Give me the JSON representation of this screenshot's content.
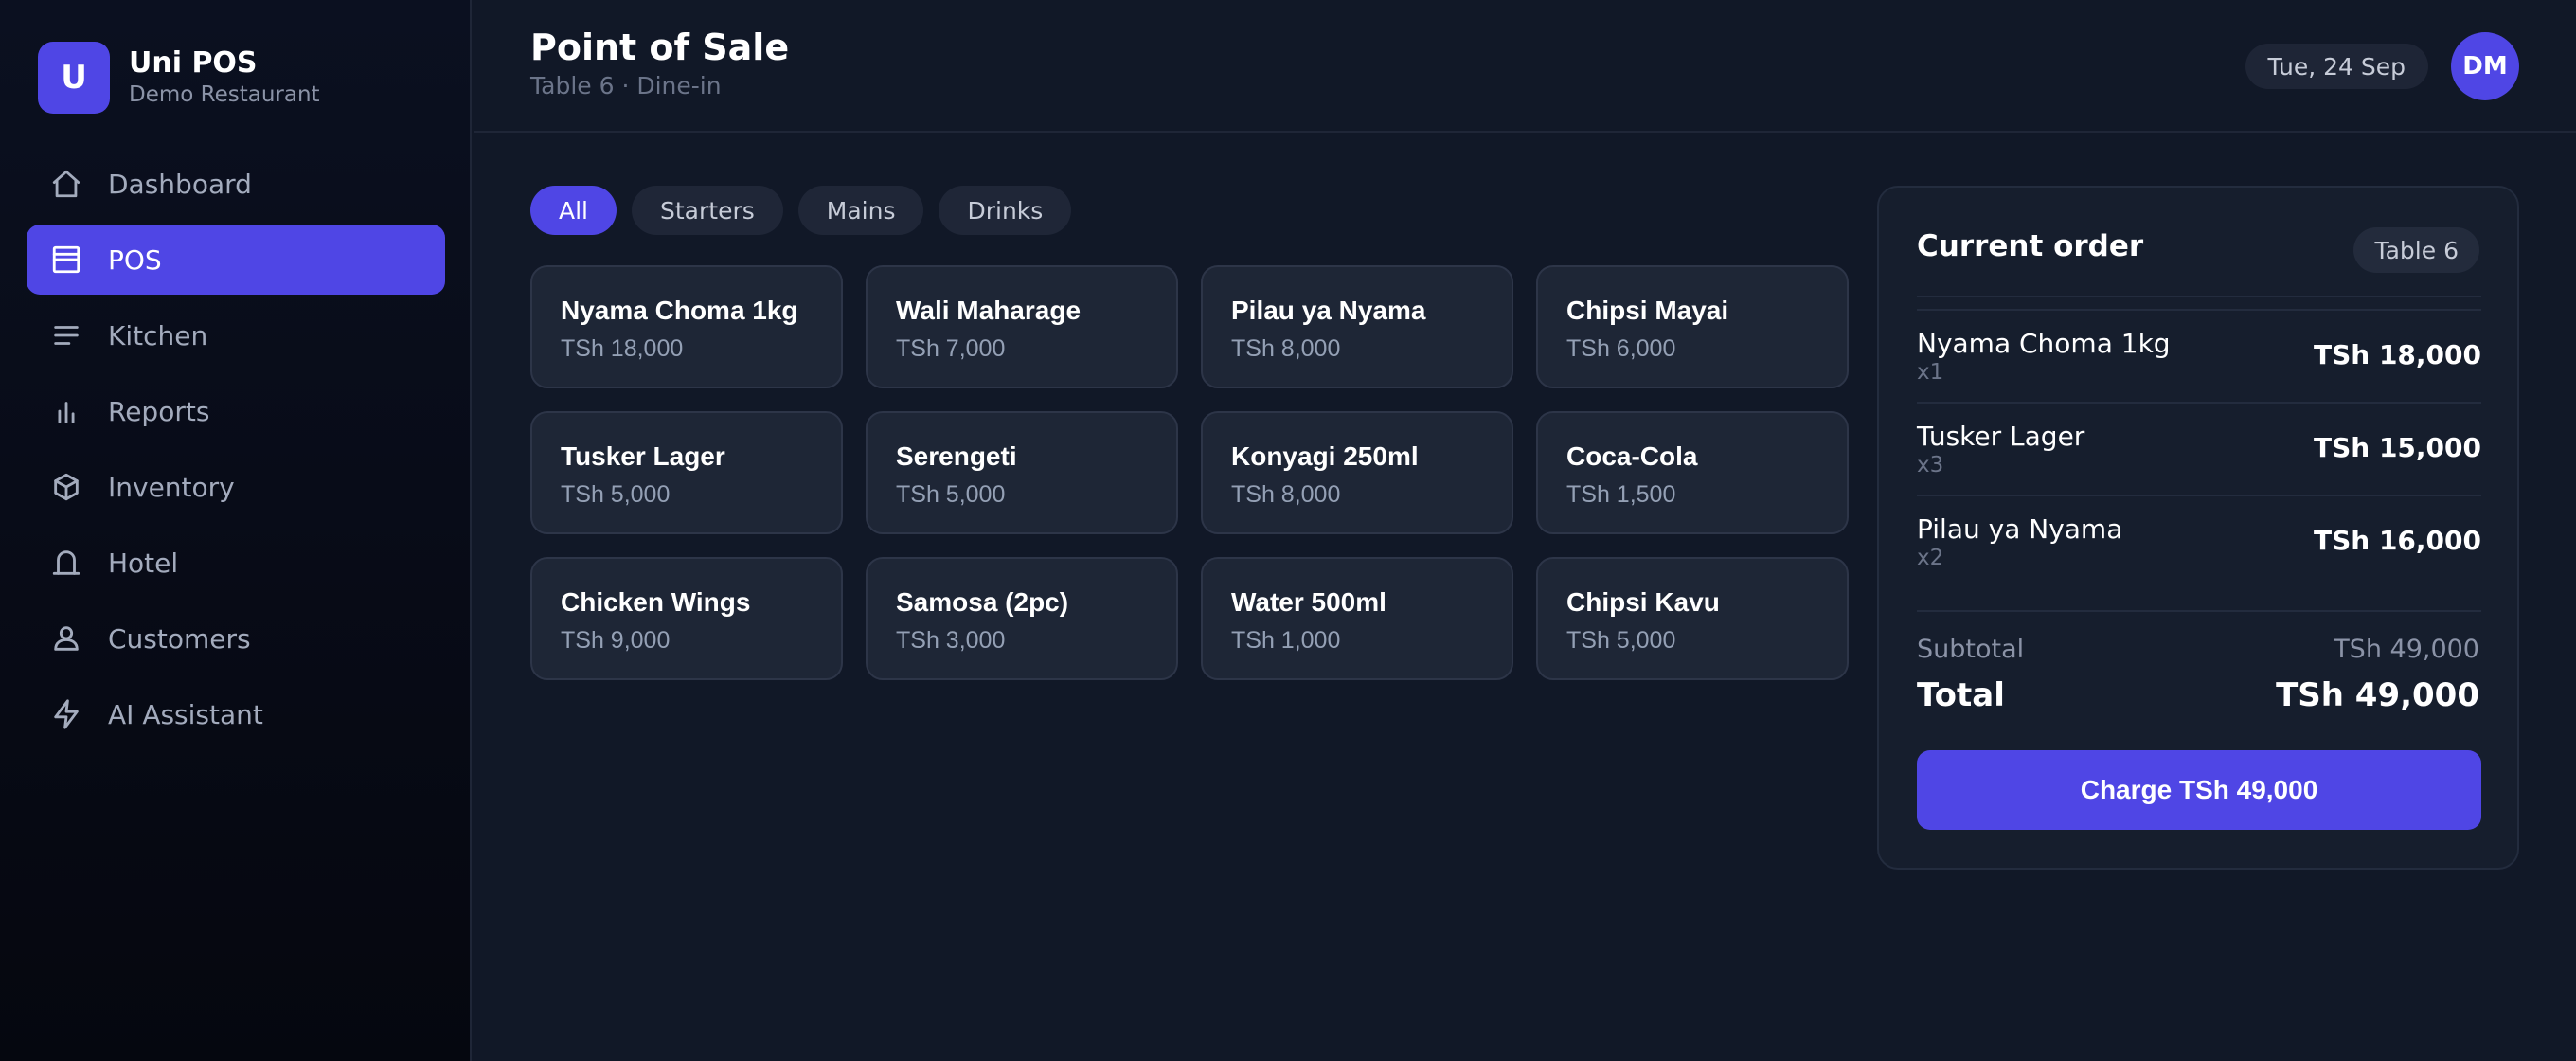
{
  "brand": {
    "logo_letter": "U",
    "name": "Uni POS",
    "subtitle": "Demo Restaurant"
  },
  "sidebar": {
    "items": [
      {
        "label": "Dashboard",
        "icon": "home-icon",
        "active": false
      },
      {
        "label": "POS",
        "icon": "register-icon",
        "active": true
      },
      {
        "label": "Kitchen",
        "icon": "list-icon",
        "active": false
      },
      {
        "label": "Reports",
        "icon": "bar-chart-icon",
        "active": false
      },
      {
        "label": "Inventory",
        "icon": "box-icon",
        "active": false
      },
      {
        "label": "Hotel",
        "icon": "bell-icon",
        "active": false
      },
      {
        "label": "Customers",
        "icon": "user-icon",
        "active": false
      },
      {
        "label": "AI Assistant",
        "icon": "bolt-icon",
        "active": false
      }
    ]
  },
  "header": {
    "title": "Point of Sale",
    "subtitle": "Table 6 · Dine-in",
    "date": "Tue, 24 Sep",
    "avatar_initials": "DM"
  },
  "categories": [
    {
      "label": "All",
      "active": true
    },
    {
      "label": "Starters",
      "active": false
    },
    {
      "label": "Mains",
      "active": false
    },
    {
      "label": "Drinks",
      "active": false
    }
  ],
  "products": [
    {
      "name": "Nyama Choma 1kg",
      "price": "TSh 18,000"
    },
    {
      "name": "Wali Maharage",
      "price": "TSh 7,000"
    },
    {
      "name": "Pilau ya Nyama",
      "price": "TSh 8,000"
    },
    {
      "name": "Chipsi Mayai",
      "price": "TSh 6,000"
    },
    {
      "name": "Tusker Lager",
      "price": "TSh 5,000"
    },
    {
      "name": "Serengeti",
      "price": "TSh 5,000"
    },
    {
      "name": "Konyagi 250ml",
      "price": "TSh 8,000"
    },
    {
      "name": "Coca-Cola",
      "price": "TSh 1,500"
    },
    {
      "name": "Chicken Wings",
      "price": "TSh 9,000"
    },
    {
      "name": "Samosa (2pc)",
      "price": "TSh 3,000"
    },
    {
      "name": "Water 500ml",
      "price": "TSh 1,000"
    },
    {
      "name": "Chipsi Kavu",
      "price": "TSh 5,000"
    }
  ],
  "order": {
    "title": "Current order",
    "table_badge": "Table 6",
    "items": [
      {
        "name": "Nyama Choma 1kg",
        "qty": "x1",
        "price": "TSh 18,000"
      },
      {
        "name": "Tusker Lager",
        "qty": "x3",
        "price": "TSh 15,000"
      },
      {
        "name": "Pilau ya Nyama",
        "qty": "x2",
        "price": "TSh 16,000"
      }
    ],
    "subtotal_label": "Subtotal",
    "subtotal_value": "TSh 49,000",
    "total_label": "Total",
    "total_value": "TSh 49,000",
    "charge_label": "Charge TSh 49,000"
  },
  "colors": {
    "accent": "#4f46e5",
    "background": "#111827",
    "sidebar": "#05070f",
    "card": "#1e2636"
  }
}
